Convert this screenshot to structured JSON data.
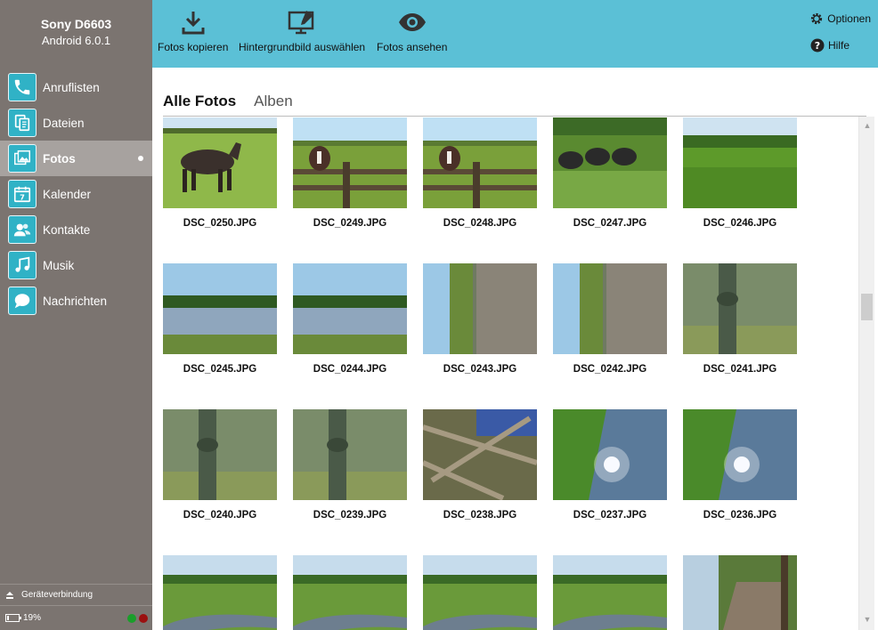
{
  "device": {
    "name": "Sony D6603",
    "os": "Android 6.0.1"
  },
  "nav": {
    "items": [
      {
        "label": "Anruflisten",
        "icon": "phone-icon"
      },
      {
        "label": "Dateien",
        "icon": "files-icon"
      },
      {
        "label": "Fotos",
        "icon": "photos-icon",
        "active": true
      },
      {
        "label": "Kalender",
        "icon": "calendar-icon"
      },
      {
        "label": "Kontakte",
        "icon": "contacts-icon"
      },
      {
        "label": "Musik",
        "icon": "music-icon"
      },
      {
        "label": "Nachrichten",
        "icon": "messages-icon"
      }
    ],
    "calendar_day": "7"
  },
  "toolbar": {
    "copy_label": "Fotos kopieren",
    "wallpaper_label": "Hintergrundbild auswählen",
    "view_label": "Fotos ansehen",
    "options_label": "Optionen",
    "help_label": "Hilfe"
  },
  "tabs": {
    "all_photos": "Alle Fotos",
    "albums": "Alben"
  },
  "photos": [
    {
      "name": "DSC_0250.JPG",
      "scene": "horse"
    },
    {
      "name": "DSC_0249.JPG",
      "scene": "horse-fence"
    },
    {
      "name": "DSC_0248.JPG",
      "scene": "horse-fence"
    },
    {
      "name": "DSC_0247.JPG",
      "scene": "tires"
    },
    {
      "name": "DSC_0246.JPG",
      "scene": "meadow"
    },
    {
      "name": "DSC_0245.JPG",
      "scene": "lake"
    },
    {
      "name": "DSC_0244.JPG",
      "scene": "lake"
    },
    {
      "name": "DSC_0243.JPG",
      "scene": "reflection"
    },
    {
      "name": "DSC_0242.JPG",
      "scene": "reflection"
    },
    {
      "name": "DSC_0241.JPG",
      "scene": "shadow"
    },
    {
      "name": "DSC_0240.JPG",
      "scene": "shadow"
    },
    {
      "name": "DSC_0239.JPG",
      "scene": "shadow"
    },
    {
      "name": "DSC_0238.JPG",
      "scene": "branches"
    },
    {
      "name": "DSC_0237.JPG",
      "scene": "sun-water"
    },
    {
      "name": "DSC_0236.JPG",
      "scene": "sun-water"
    },
    {
      "name": "",
      "scene": "creek"
    },
    {
      "name": "",
      "scene": "creek"
    },
    {
      "name": "",
      "scene": "creek"
    },
    {
      "name": "",
      "scene": "creek"
    },
    {
      "name": "",
      "scene": "bridge"
    }
  ],
  "status": {
    "connection_label": "Geräteverbindung",
    "battery_percent": "19%",
    "battery_level": 0.19,
    "indicator_colors": [
      "#1a9e2a",
      "#9b1010"
    ]
  },
  "colors": {
    "accent": "#30b2c6",
    "toolbar": "#5bc0d6",
    "sidebar": "#7b7470"
  }
}
